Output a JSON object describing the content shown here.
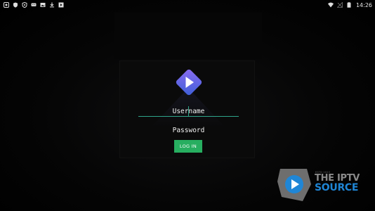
{
  "status_bar": {
    "left_icons": [
      "app-notification-icon",
      "shield-icon",
      "shield-check-icon",
      "chat-bubble-icon",
      "image-icon",
      "download-icon",
      "media-icon"
    ],
    "right_icons": [
      "wifi-icon",
      "no-signal-icon",
      "battery-icon"
    ],
    "time": "14:26"
  },
  "login": {
    "logo_icon": "play-diamond-logo",
    "username_placeholder": "Username",
    "password_placeholder": "Password",
    "login_label": "LOG IN"
  },
  "watermark": {
    "established": "ESTD 2023",
    "title": "THE IPTV",
    "subtitle": "SOURCE"
  },
  "colors": {
    "accent": "#27ae60",
    "underline": "#2fa58a",
    "logo_gradient_start": "#8a6cf0",
    "logo_gradient_end": "#3d5fd8",
    "watermark_blue": "#1f86d6"
  }
}
